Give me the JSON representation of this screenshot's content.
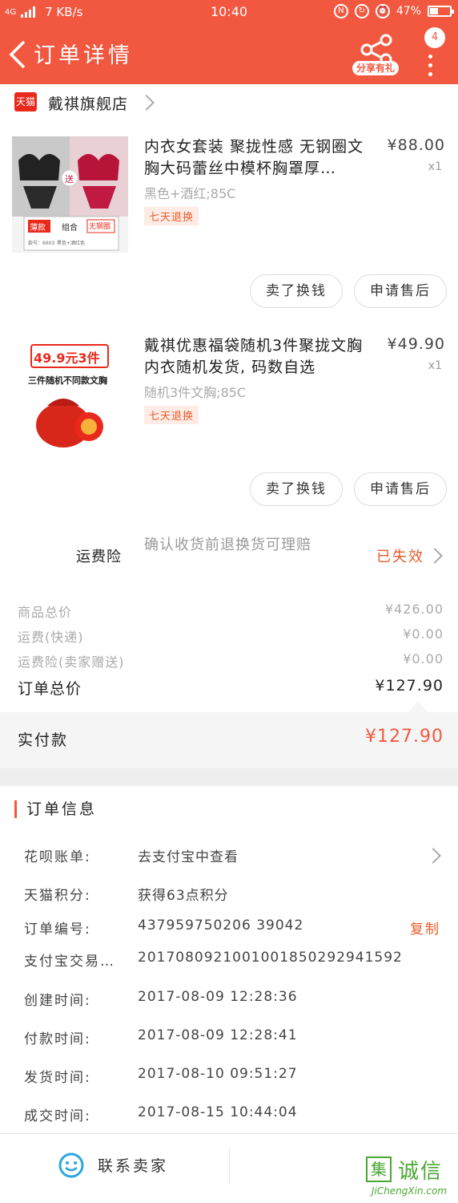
{
  "status_bar": {
    "network": "4G",
    "speed": "7 KB/s",
    "time": "10:40",
    "battery": "47%"
  },
  "header": {
    "title": "订单详情",
    "share_label": "分享有礼",
    "badge_count": "4"
  },
  "store": {
    "badge": "天猫",
    "name": "戴祺旗舰店"
  },
  "items": [
    {
      "name": "内衣女套装 聚拢性感 无钢圈文胸大码蕾丝中模杯胸罩厚…",
      "price": "¥88.00",
      "qty": "x1",
      "spec": "黑色+酒红;85C",
      "tag": "七天退换",
      "thumb": {
        "badge_send": "送",
        "label_thin": "薄款",
        "label_combo": "组合",
        "label_nowire": "无钢圈",
        "caption_code": "款号：6603",
        "caption_color": "黑色+酒红色"
      },
      "btn_sell": "卖了换钱",
      "btn_after": "申请售后"
    },
    {
      "name": "戴祺优惠福袋随机3件聚拢文胸 内衣随机发货, 码数自选",
      "price": "¥49.90",
      "qty": "x1",
      "spec": "随机3件文胸;85C",
      "tag": "七天退换",
      "thumb": {
        "promo": "49.9元3件",
        "sub": "三件随机不同款文胸"
      },
      "btn_sell": "卖了换钱",
      "btn_after": "申请售后"
    }
  ],
  "insurance": {
    "label": "运费险",
    "desc": "确认收货前退换货可理赔",
    "state": "已失效"
  },
  "totals": [
    {
      "k": "商品总价",
      "v": "¥426.00"
    },
    {
      "k": "运费(快递)",
      "v": "¥0.00"
    },
    {
      "k": "运费险(卖家赠送)",
      "v": "¥0.00"
    },
    {
      "k": "订单总价",
      "v": "¥127.90"
    }
  ],
  "paid": {
    "k": "实付款",
    "v": "¥127.90"
  },
  "order_info": {
    "title": "订单信息",
    "rows": [
      {
        "k": "花呗账单:",
        "v": "去支付宝中查看"
      },
      {
        "k": "天猫积分:",
        "v": "获得63点积分"
      },
      {
        "k": "订单编号:",
        "v": "437959750206 39042",
        "copy": "复制"
      },
      {
        "k": "支付宝交易…",
        "v": "2017080921001001850292941592"
      },
      {
        "k": "创建时间:",
        "v": "2017-08-09 12:28:36"
      },
      {
        "k": "付款时间:",
        "v": "2017-08-09 12:28:41"
      },
      {
        "k": "发货时间:",
        "v": "2017-08-10 09:51:27"
      },
      {
        "k": "成交时间:",
        "v": "2017-08-15 10:44:04"
      }
    ]
  },
  "bottom": {
    "contact": "联系卖家"
  },
  "watermark": {
    "mark": "集",
    "chars": "诚信",
    "site": "JiChengXin.com"
  },
  "colors": {
    "brand": "#f25840",
    "accent": "#e85a2a",
    "tmall": "#e8291c"
  }
}
